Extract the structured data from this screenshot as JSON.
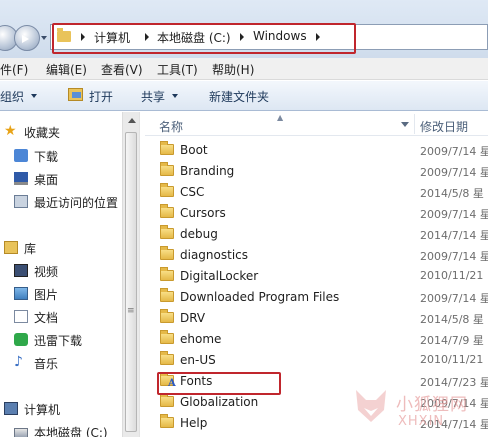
{
  "address": {
    "crumbs": [
      "计算机",
      "本地磁盘 (C:)",
      "Windows"
    ]
  },
  "menu": [
    "件(F)",
    "编辑(E)",
    "查看(V)",
    "工具(T)",
    "帮助(H)"
  ],
  "toolbar": {
    "organize": "组织",
    "open": "打开",
    "share": "共享",
    "new_folder": "新建文件夹"
  },
  "nav": {
    "favorites": "收藏夹",
    "downloads": "下载",
    "desktop": "桌面",
    "recent": "最近访问的位置",
    "libraries": "库",
    "videos": "视频",
    "pictures": "图片",
    "documents": "文档",
    "xunlei": "迅雷下载",
    "music": "音乐",
    "computer": "计算机",
    "local_disk": "本地磁盘 (C:)"
  },
  "columns": {
    "name": "名称",
    "date": "修改日期"
  },
  "files": [
    {
      "name": "Boot",
      "date": "2009/7/14 星"
    },
    {
      "name": "Branding",
      "date": "2009/7/14 星"
    },
    {
      "name": "CSC",
      "date": "2014/5/8 星"
    },
    {
      "name": "Cursors",
      "date": "2009/7/14 星"
    },
    {
      "name": "debug",
      "date": "2014/7/14 星"
    },
    {
      "name": "diagnostics",
      "date": "2009/7/14 星"
    },
    {
      "name": "DigitalLocker",
      "date": "2010/11/21"
    },
    {
      "name": "Downloaded Program Files",
      "date": "2009/7/14 星"
    },
    {
      "name": "DRV",
      "date": "2014/5/8 星"
    },
    {
      "name": "ehome",
      "date": "2014/7/9 星"
    },
    {
      "name": "en-US",
      "date": "2010/11/21"
    },
    {
      "name": "Fonts",
      "date": "2014/7/23 星"
    },
    {
      "name": "Globalization",
      "date": "2009/7/14 星"
    },
    {
      "name": "Help",
      "date": "2014/7/14 星"
    }
  ],
  "watermark": {
    "cn": "小狐狸网",
    "en": "XHXIN"
  },
  "colors": {
    "highlight": "#c0262d",
    "toolbar_text": "#1e395b"
  }
}
